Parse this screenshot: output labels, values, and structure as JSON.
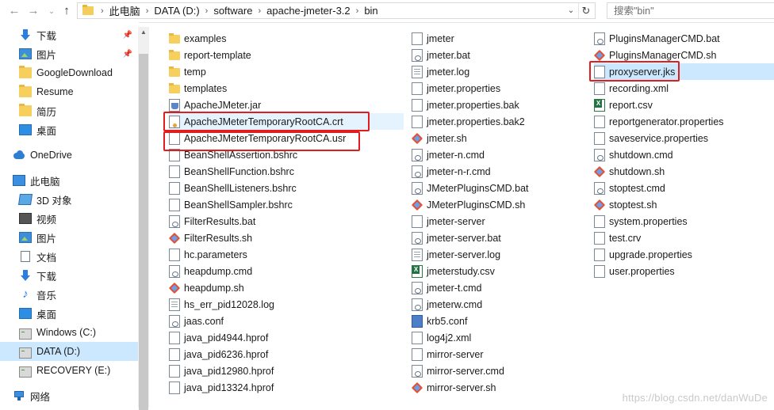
{
  "address_bar": {
    "breadcrumbs": [
      "此电脑",
      "DATA (D:)",
      "software",
      "apache-jmeter-3.2",
      "bin"
    ],
    "search_placeholder": "搜索\"bin\""
  },
  "sidebar": {
    "items": [
      {
        "label": "下载",
        "icon": "download-icon",
        "pinned": true
      },
      {
        "label": "图片",
        "icon": "pictures-icon",
        "pinned": true
      },
      {
        "label": "GoogleDownload",
        "icon": "folder-icon"
      },
      {
        "label": "Resume",
        "icon": "folder-icon"
      },
      {
        "label": "简历",
        "icon": "folder-icon"
      },
      {
        "label": "桌面",
        "icon": "desktop-icon"
      },
      {
        "label": "OneDrive",
        "icon": "onedrive-icon"
      },
      {
        "label": "此电脑",
        "icon": "this-pc-icon"
      },
      {
        "label": "3D 对象",
        "icon": "3d-objects-icon"
      },
      {
        "label": "视频",
        "icon": "videos-icon"
      },
      {
        "label": "图片",
        "icon": "pictures-icon"
      },
      {
        "label": "文档",
        "icon": "documents-icon"
      },
      {
        "label": "下载",
        "icon": "download-icon"
      },
      {
        "label": "音乐",
        "icon": "music-icon"
      },
      {
        "label": "桌面",
        "icon": "desktop-icon"
      },
      {
        "label": "Windows (C:)",
        "icon": "drive-icon"
      },
      {
        "label": "DATA (D:)",
        "icon": "drive-icon",
        "selected": true
      },
      {
        "label": "RECOVERY (E:)",
        "icon": "drive-icon"
      },
      {
        "label": "网络",
        "icon": "network-icon"
      }
    ]
  },
  "files": {
    "columns": [
      [
        {
          "name": "examples",
          "icon": "folder-icon"
        },
        {
          "name": "report-template",
          "icon": "folder-icon"
        },
        {
          "name": "temp",
          "icon": "folder-icon"
        },
        {
          "name": "templates",
          "icon": "folder-icon"
        },
        {
          "name": "ApacheJMeter.jar",
          "icon": "jar-file-icon"
        },
        {
          "name": "ApacheJMeterTemporaryRootCA.crt",
          "icon": "certificate-file-icon",
          "hover": true
        },
        {
          "name": "ApacheJMeterTemporaryRootCA.usr",
          "icon": "file-icon"
        },
        {
          "name": "BeanShellAssertion.bshrc",
          "icon": "file-icon"
        },
        {
          "name": "BeanShellFunction.bshrc",
          "icon": "file-icon"
        },
        {
          "name": "BeanShellListeners.bshrc",
          "icon": "file-icon"
        },
        {
          "name": "BeanShellSampler.bshrc",
          "icon": "file-icon"
        },
        {
          "name": "FilterResults.bat",
          "icon": "batch-file-icon"
        },
        {
          "name": "FilterResults.sh",
          "icon": "git-shell-icon"
        },
        {
          "name": "hc.parameters",
          "icon": "file-icon"
        },
        {
          "name": "heapdump.cmd",
          "icon": "batch-file-icon"
        },
        {
          "name": "heapdump.sh",
          "icon": "git-shell-icon"
        },
        {
          "name": "hs_err_pid12028.log",
          "icon": "text-file-icon"
        },
        {
          "name": "jaas.conf",
          "icon": "conf-file-icon"
        },
        {
          "name": "java_pid4944.hprof",
          "icon": "file-icon"
        },
        {
          "name": "java_pid6236.hprof",
          "icon": "file-icon"
        },
        {
          "name": "java_pid12980.hprof",
          "icon": "file-icon"
        },
        {
          "name": "java_pid13324.hprof",
          "icon": "file-icon"
        }
      ],
      [
        {
          "name": "jmeter",
          "icon": "file-icon"
        },
        {
          "name": "jmeter.bat",
          "icon": "batch-file-icon"
        },
        {
          "name": "jmeter.log",
          "icon": "text-file-icon"
        },
        {
          "name": "jmeter.properties",
          "icon": "file-icon"
        },
        {
          "name": "jmeter.properties.bak",
          "icon": "file-icon"
        },
        {
          "name": "jmeter.properties.bak2",
          "icon": "file-icon"
        },
        {
          "name": "jmeter.sh",
          "icon": "git-shell-icon"
        },
        {
          "name": "jmeter-n.cmd",
          "icon": "batch-file-icon"
        },
        {
          "name": "jmeter-n-r.cmd",
          "icon": "batch-file-icon"
        },
        {
          "name": "JMeterPluginsCMD.bat",
          "icon": "batch-file-icon"
        },
        {
          "name": "JMeterPluginsCMD.sh",
          "icon": "git-shell-icon"
        },
        {
          "name": "jmeter-server",
          "icon": "file-icon"
        },
        {
          "name": "jmeter-server.bat",
          "icon": "batch-file-icon"
        },
        {
          "name": "jmeter-server.log",
          "icon": "text-file-icon"
        },
        {
          "name": "jmeterstudy.csv",
          "icon": "excel-file-icon"
        },
        {
          "name": "jmeter-t.cmd",
          "icon": "batch-file-icon"
        },
        {
          "name": "jmeterw.cmd",
          "icon": "batch-file-icon"
        },
        {
          "name": "krb5.conf",
          "icon": "conf-file-icon"
        },
        {
          "name": "log4j2.xml",
          "icon": "file-icon"
        },
        {
          "name": "mirror-server",
          "icon": "file-icon"
        },
        {
          "name": "mirror-server.cmd",
          "icon": "batch-file-icon"
        },
        {
          "name": "mirror-server.sh",
          "icon": "git-shell-icon"
        }
      ],
      [
        {
          "name": "PluginsManagerCMD.bat",
          "icon": "batch-file-icon"
        },
        {
          "name": "PluginsManagerCMD.sh",
          "icon": "git-shell-icon"
        },
        {
          "name": "proxyserver.jks",
          "icon": "file-icon",
          "selected": true
        },
        {
          "name": "recording.xml",
          "icon": "file-icon"
        },
        {
          "name": "report.csv",
          "icon": "excel-file-icon"
        },
        {
          "name": "reportgenerator.properties",
          "icon": "file-icon"
        },
        {
          "name": "saveservice.properties",
          "icon": "file-icon"
        },
        {
          "name": "shutdown.cmd",
          "icon": "batch-file-icon"
        },
        {
          "name": "shutdown.sh",
          "icon": "git-shell-icon"
        },
        {
          "name": "stoptest.cmd",
          "icon": "batch-file-icon"
        },
        {
          "name": "stoptest.sh",
          "icon": "git-shell-icon"
        },
        {
          "name": "system.properties",
          "icon": "file-icon"
        },
        {
          "name": "test.crv",
          "icon": "file-icon"
        },
        {
          "name": "upgrade.properties",
          "icon": "file-icon"
        },
        {
          "name": "user.properties",
          "icon": "file-icon"
        }
      ]
    ]
  },
  "watermark": "https://blog.csdn.net/danWuDe",
  "colors": {
    "selection": "#cce8ff",
    "hover": "#e5f3ff",
    "annotation_red": "#e11d1d"
  }
}
